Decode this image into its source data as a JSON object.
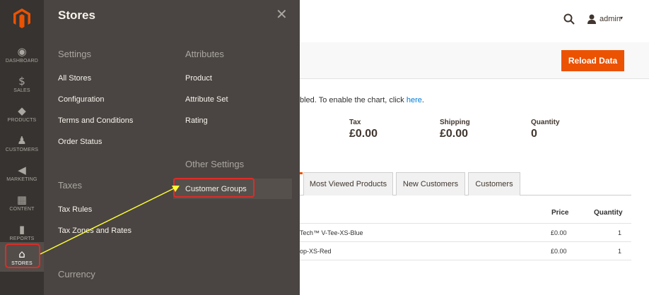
{
  "nav": {
    "items": [
      {
        "label": "DASHBOARD",
        "icon": "dashboard-icon",
        "glyph": "◉"
      },
      {
        "label": "SALES",
        "icon": "dollar-icon",
        "glyph": "$"
      },
      {
        "label": "PRODUCTS",
        "icon": "cube-icon",
        "glyph": "◆"
      },
      {
        "label": "CUSTOMERS",
        "icon": "person-icon",
        "glyph": "♟"
      },
      {
        "label": "MARKETING",
        "icon": "megaphone-icon",
        "glyph": "◀"
      },
      {
        "label": "CONTENT",
        "icon": "layout-icon",
        "glyph": "▦"
      },
      {
        "label": "REPORTS",
        "icon": "bar-chart-icon",
        "glyph": "▮"
      },
      {
        "label": "STORES",
        "icon": "storefront-icon",
        "glyph": "⌂"
      }
    ]
  },
  "flyout": {
    "title": "Stores",
    "close_glyph": "✕",
    "settings": {
      "heading": "Settings",
      "links": [
        "All Stores",
        "Configuration",
        "Terms and Conditions",
        "Order Status"
      ]
    },
    "taxes": {
      "heading": "Taxes",
      "links": [
        "Tax Rules",
        "Tax Zones and Rates"
      ]
    },
    "currency": {
      "heading": "Currency"
    },
    "attributes": {
      "heading": "Attributes",
      "links": [
        "Product",
        "Attribute Set",
        "Rating"
      ]
    },
    "other": {
      "heading": "Other Settings",
      "links": [
        "Customer Groups"
      ]
    }
  },
  "header": {
    "user": "admin",
    "caret": "▾"
  },
  "actions": {
    "reload": "Reload Data"
  },
  "dashboard": {
    "notice_text": "bled. To enable the chart, click ",
    "notice_link": "here",
    "notice_end": ".",
    "stats": [
      {
        "label": "Tax",
        "value": "£0.00"
      },
      {
        "label": "Shipping",
        "value": "£0.00"
      },
      {
        "label": "Quantity",
        "value": "0"
      }
    ],
    "tabs": [
      "Most Viewed Products",
      "New Customers",
      "Customers"
    ],
    "columns": {
      "price": "Price",
      "quantity": "Quantity"
    },
    "rows": [
      {
        "product": "Tech™ V-Tee-XS-Blue",
        "price": "£0.00",
        "quantity": "1"
      },
      {
        "product": "op-XS-Red",
        "price": "£0.00",
        "quantity": "1"
      }
    ]
  },
  "colors": {
    "accent": "#eb5202",
    "highlight": "#e02b27",
    "arrow": "#ffff33"
  }
}
